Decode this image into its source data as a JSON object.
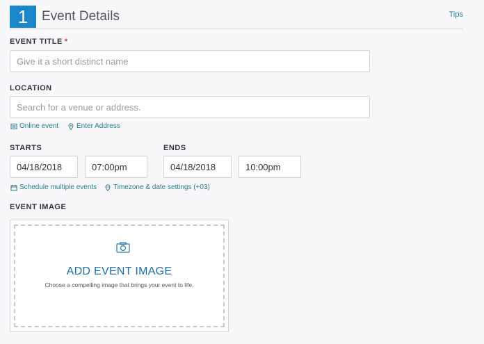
{
  "header": {
    "step_number": "1",
    "title": "Event Details",
    "tips_label": "Tips"
  },
  "event_title": {
    "label": "EVENT TITLE",
    "required_mark": "*",
    "placeholder": "Give it a short distinct name",
    "value": ""
  },
  "location": {
    "label": "LOCATION",
    "placeholder": "Search for a venue or address.",
    "value": "",
    "online_event_label": "Online event",
    "enter_address_label": "Enter Address"
  },
  "starts": {
    "label": "STARTS",
    "date": "04/18/2018",
    "time": "07:00pm"
  },
  "ends": {
    "label": "ENDS",
    "date": "04/18/2018",
    "time": "10:00pm"
  },
  "schedule": {
    "multiple_events_label": "Schedule multiple events",
    "timezone_label": "Timezone & date settings (+03)"
  },
  "event_image": {
    "label": "EVENT IMAGE",
    "add_label": "ADD EVENT IMAGE",
    "description": "Choose a compelling image that brings your event to life."
  },
  "colors": {
    "accent": "#1b87c9",
    "link": "#2a7d86",
    "required": "#d6304a"
  },
  "icons": {
    "online_event": "calendar-list-icon",
    "enter_address": "map-pin-icon",
    "schedule_multiple": "calendar-icon",
    "timezone": "globe-pin-icon",
    "image_upload": "camera-icon"
  }
}
